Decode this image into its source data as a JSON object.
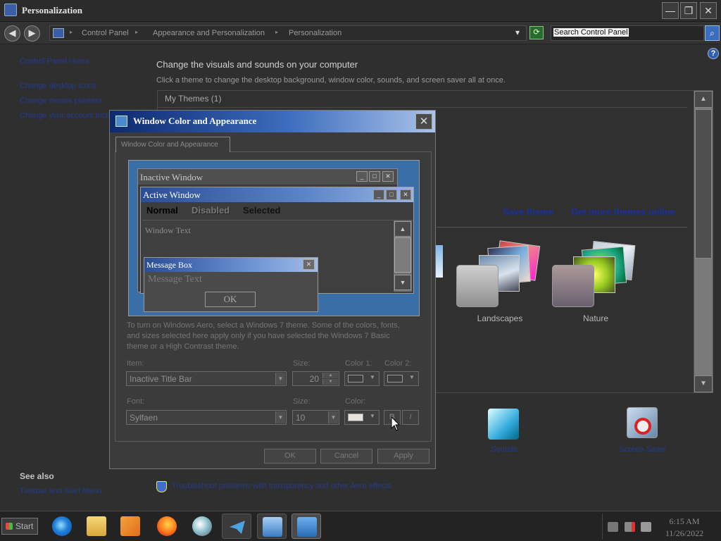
{
  "window": {
    "title": "Personalization",
    "controls": {
      "minimize": "—",
      "maximize": "❐",
      "close": "✕"
    }
  },
  "nav": {
    "back": "◀",
    "forward": "▶",
    "breadcrumbs": [
      "Control Panel",
      "Appearance and Personalization",
      "Personalization"
    ],
    "breadcrumb_sep": "▸",
    "dropdown": "▾",
    "refresh": "⟳",
    "search_placeholder": "Search Control Panel",
    "search_icon": "⌕"
  },
  "sidebar": {
    "home": "Control Panel Home",
    "links": [
      "Change desktop icons",
      "Change mouse pointers",
      "Change your account picture"
    ]
  },
  "help": "?",
  "main": {
    "heading": "Change the visuals and sounds on your computer",
    "subtitle": "Click a theme to change the desktop background, window color, sounds, and screen saver all at once.",
    "group": "My Themes (1)",
    "save_theme": "Save theme",
    "get_more": "Get more themes online",
    "themes": [
      {
        "name": "Landscapes"
      },
      {
        "name": "Nature"
      }
    ],
    "scroll_up": "▲",
    "scroll_down": "▼",
    "bottom_items": [
      "Sounds",
      "Screen Saver"
    ]
  },
  "see_also": {
    "heading": "See also",
    "links": [
      "Taskbar and Start Menu"
    ]
  },
  "troubleshoot": "Troubleshoot problems with transparency and other Aero effects",
  "dialog": {
    "title": "Window Color and Appearance",
    "close": "✕",
    "tab": "Window Color and Appearance",
    "preview": {
      "inactive_title": "Inactive Window",
      "active_title": "Active Window",
      "menu": {
        "normal": "Normal",
        "disabled": "Disabled",
        "selected": "Selected"
      },
      "window_text": "Window Text",
      "msgbox_title": "Message Box",
      "msgbox_text": "Message Text",
      "ok": "OK",
      "btn_min": "_",
      "btn_max": "□",
      "btn_close": "✕",
      "scroll_up": "▲",
      "scroll_down": "▼"
    },
    "aero_note": "To turn on Windows Aero, select a Windows 7 theme.  Some of the colors, fonts, and sizes selected here apply only if you have selected the Windows 7 Basic theme or a High Contrast theme.",
    "item_label": "Item:",
    "item_value": "Inactive Title Bar",
    "size_label": "Size:",
    "item_size": "20",
    "color1_label": "Color 1:",
    "color2_label": "Color 2:",
    "font_label": "Font:",
    "font_value": "Sylfaen",
    "font_size_label": "Size:",
    "font_size": "10",
    "font_color_label": "Color:",
    "bold": "B",
    "italic": "I",
    "combo_arrow": "▼",
    "buttons": {
      "ok": "OK",
      "cancel": "Cancel",
      "apply": "Apply"
    },
    "colors": {
      "color1": "#3c3c3c",
      "color2": "#3c3c3c",
      "font_color": "#e8e6dc"
    }
  },
  "taskbar": {
    "start": "Start",
    "apps": [
      "internet-explorer",
      "windows-explorer",
      "media-player",
      "firefox",
      "paint",
      "telegram",
      "remote-desktop",
      "control-panel"
    ],
    "clock_time": "6:15 AM",
    "clock_date": "11/26/2022"
  }
}
